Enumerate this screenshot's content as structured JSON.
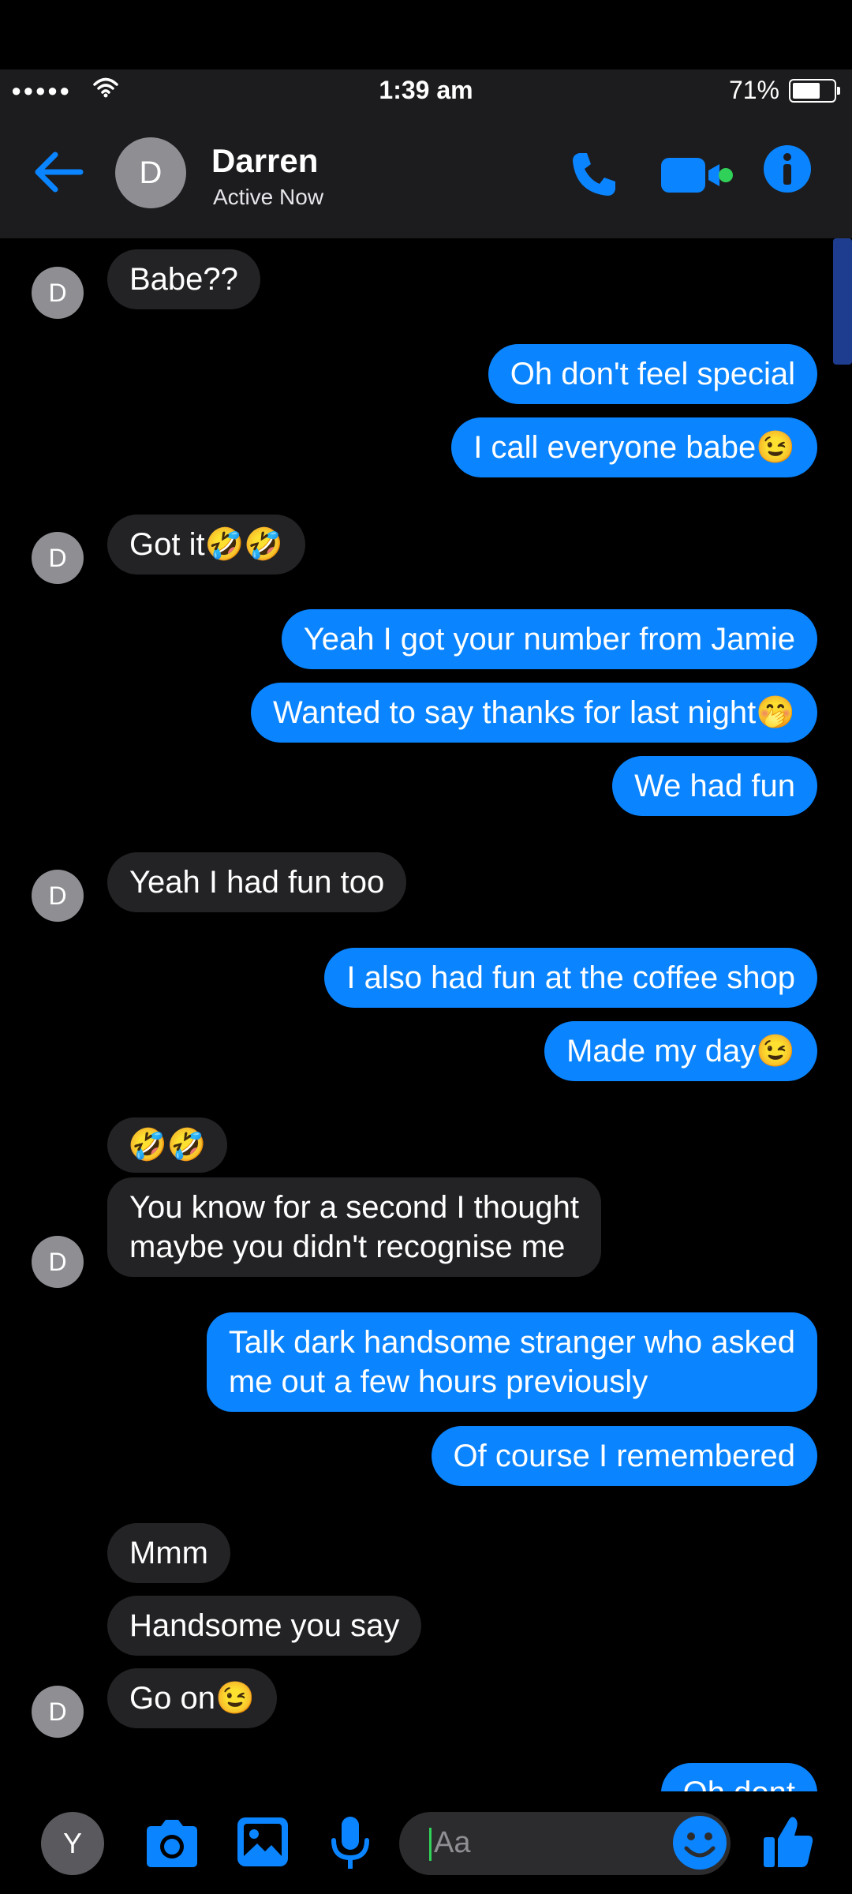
{
  "status_bar": {
    "signal": "●●●●●",
    "time": "1:39 am",
    "battery": "71%",
    "battery_level": 0.71
  },
  "header": {
    "back_icon": "back-arrow-icon",
    "avatar_initial": "D",
    "name": "Darren",
    "status": "Active Now",
    "icons": [
      "phone-icon",
      "video-camera-icon",
      "info-icon"
    ],
    "accent_color": "#0a84ff"
  },
  "messages": [
    {
      "dir": "in",
      "text": "Babe??"
    },
    {
      "dir": "out",
      "text": "Oh don't feel special"
    },
    {
      "dir": "out",
      "text": "I call everyone babe😉"
    },
    {
      "dir": "in",
      "text": "Got it🤣🤣"
    },
    {
      "dir": "out",
      "text": "Yeah I got your number from Jamie"
    },
    {
      "dir": "out",
      "text": "Wanted to say thanks for last night🤭"
    },
    {
      "dir": "out",
      "text": "We had fun"
    },
    {
      "dir": "in",
      "text": "Yeah I had fun too"
    },
    {
      "dir": "out",
      "text": "I also had fun at the coffee shop"
    },
    {
      "dir": "out",
      "text": "Made my day😉"
    },
    {
      "dir": "in",
      "text": "🤣🤣"
    },
    {
      "dir": "in",
      "text": "You know for a second I thought\nmaybe you didn't recognise me"
    },
    {
      "dir": "out",
      "text": "Talk dark handsome stranger who asked\nme out a few hours previously"
    },
    {
      "dir": "out",
      "text": "Of course I remembered"
    },
    {
      "dir": "in",
      "text": "Mmm"
    },
    {
      "dir": "in",
      "text": "Handsome you say"
    },
    {
      "dir": "in",
      "text": "Go on😉"
    },
    {
      "dir": "out",
      "text": "Oh dont"
    }
  ],
  "chat_avatar_initial": "D",
  "composer": {
    "me_initial": "Y",
    "placeholder": "Aa",
    "icons": [
      "camera-icon",
      "gallery-icon",
      "microphone-icon",
      "emoji-icon",
      "thumbs-up-icon"
    ]
  }
}
